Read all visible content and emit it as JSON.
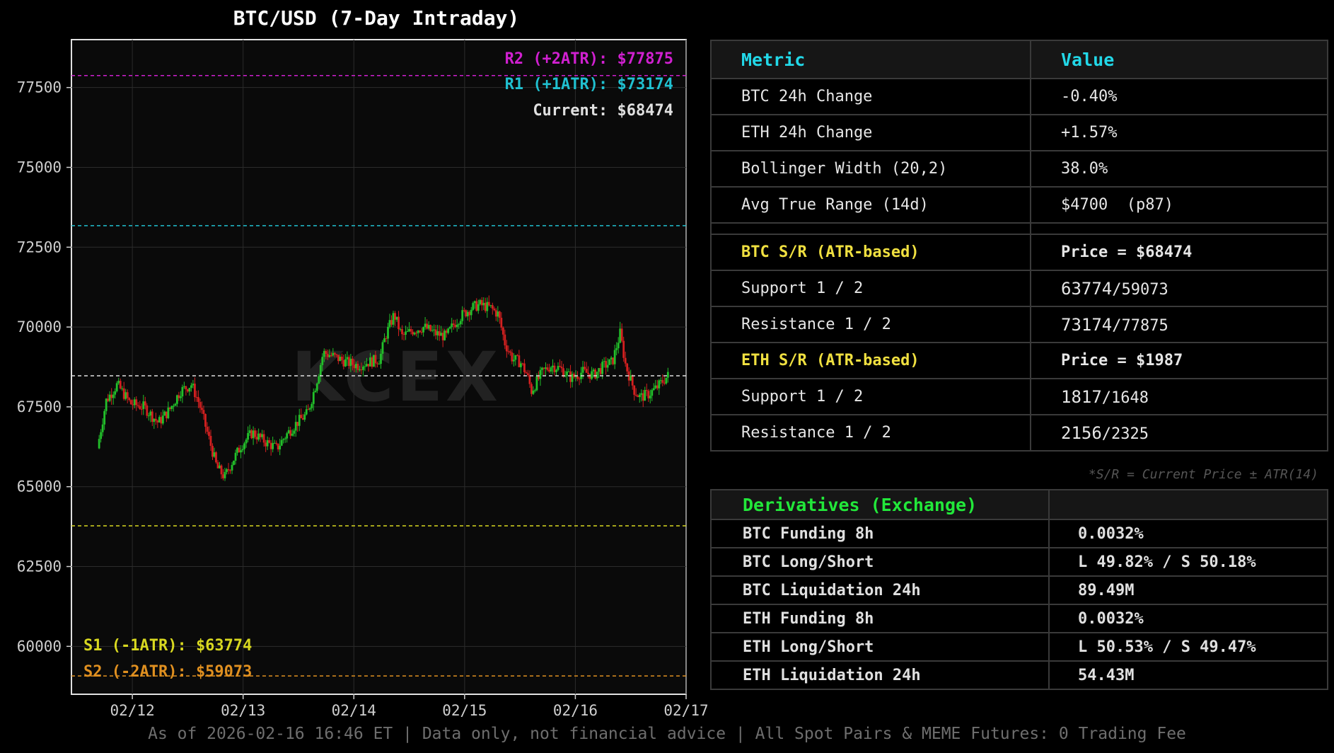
{
  "chart_data": {
    "type": "candlestick",
    "title": "BTC/USD (7-Day Intraday)",
    "xlabel": "",
    "ylabel": "",
    "x_ticks": [
      "02/12",
      "02/13",
      "02/14",
      "02/15",
      "02/16",
      "02/17"
    ],
    "y_ticks": [
      77500,
      75000,
      72500,
      70000,
      67500,
      65000,
      62500,
      60000
    ],
    "ylim": [
      58500,
      79000
    ],
    "x_range": [
      -0.55,
      5.0
    ],
    "grid": true,
    "levels": [
      {
        "label": "R2 (+2ATR): $77875",
        "value": 77875,
        "color": "#d020d0"
      },
      {
        "label": "R1 (+1ATR): $73174",
        "value": 73174,
        "color": "#20c0d0"
      },
      {
        "label": "Current: $68474",
        "value": 68474,
        "color": "#e0e0e0"
      },
      {
        "label": "S1 (-1ATR): $63774",
        "value": 63774,
        "color": "#d8d820"
      },
      {
        "label": "S2 (-2ATR): $59073",
        "value": 59073,
        "color": "#e09020"
      }
    ],
    "watermark": "KCEX",
    "price_path": [
      [
        -0.3,
        66200
      ],
      [
        -0.22,
        67700
      ],
      [
        -0.12,
        68200
      ],
      [
        0.0,
        67600
      ],
      [
        0.12,
        67500
      ],
      [
        0.25,
        67000
      ],
      [
        0.35,
        67400
      ],
      [
        0.45,
        68000
      ],
      [
        0.55,
        68200
      ],
      [
        0.62,
        67600
      ],
      [
        0.7,
        66600
      ],
      [
        0.78,
        65600
      ],
      [
        0.85,
        65300
      ],
      [
        0.92,
        65800
      ],
      [
        1.0,
        66300
      ],
      [
        1.1,
        66700
      ],
      [
        1.22,
        66400
      ],
      [
        1.32,
        66200
      ],
      [
        1.4,
        66600
      ],
      [
        1.5,
        67000
      ],
      [
        1.6,
        67300
      ],
      [
        1.68,
        68300
      ],
      [
        1.74,
        69200
      ],
      [
        1.82,
        69100
      ],
      [
        1.95,
        68900
      ],
      [
        2.05,
        68800
      ],
      [
        2.15,
        68900
      ],
      [
        2.25,
        69000
      ],
      [
        2.3,
        69700
      ],
      [
        2.38,
        70400
      ],
      [
        2.45,
        69700
      ],
      [
        2.55,
        69900
      ],
      [
        2.65,
        70000
      ],
      [
        2.75,
        69800
      ],
      [
        2.85,
        69700
      ],
      [
        2.92,
        70100
      ],
      [
        3.0,
        70400
      ],
      [
        3.08,
        70600
      ],
      [
        3.15,
        70700
      ],
      [
        3.25,
        70600
      ],
      [
        3.32,
        70400
      ],
      [
        3.38,
        69500
      ],
      [
        3.45,
        69000
      ],
      [
        3.52,
        68900
      ],
      [
        3.58,
        68500
      ],
      [
        3.62,
        68000
      ],
      [
        3.72,
        68600
      ],
      [
        3.8,
        68800
      ],
      [
        3.88,
        68700
      ],
      [
        3.98,
        68400
      ],
      [
        4.08,
        68600
      ],
      [
        4.18,
        68500
      ],
      [
        4.28,
        68800
      ],
      [
        4.35,
        68900
      ],
      [
        4.42,
        69800
      ],
      [
        4.47,
        68800
      ],
      [
        4.55,
        68000
      ],
      [
        4.6,
        67800
      ],
      [
        4.68,
        67900
      ],
      [
        4.75,
        68100
      ],
      [
        4.85,
        68474
      ]
    ]
  },
  "metrics": {
    "header": {
      "metric": "Metric",
      "value": "Value"
    },
    "rows": [
      {
        "label": "BTC 24h Change",
        "value": "-0.40%"
      },
      {
        "label": "ETH 24h Change",
        "value": "+1.57%"
      },
      {
        "label": "Bollinger Width (20,2)",
        "value": "38.0%"
      },
      {
        "label": "Avg True Range (14d)",
        "value": "$4700  (p87)"
      }
    ],
    "btc_sr": {
      "label": "BTC S/R (ATR-based)",
      "price": "Price = $68474",
      "support_label": "Support 1 / 2",
      "support_a": "63774",
      "support_b": "/59073",
      "resistance_label": "Resistance 1 / 2",
      "resistance_a": "73174",
      "resistance_b": "/77875"
    },
    "eth_sr": {
      "label": "ETH S/R (ATR-based)",
      "price": "Price = $1987",
      "support_label": "Support 1 / 2",
      "support_a": "1817",
      "support_b": "/1648",
      "resistance_label": "Resistance 1 / 2",
      "resistance_a": "2156",
      "resistance_b": "/2325"
    },
    "note": "*S/R = Current Price ± ATR(14)"
  },
  "derivatives": {
    "header": "Derivatives (Exchange)",
    "rows": [
      {
        "label": "BTC Funding 8h",
        "value": "0.0032%"
      },
      {
        "label": "BTC Long/Short",
        "value": "L 49.82% / S 50.18%"
      },
      {
        "label": "BTC Liquidation 24h",
        "value": "89.49M"
      },
      {
        "label": "ETH Funding 8h",
        "value": "0.0032%"
      },
      {
        "label": "ETH Long/Short",
        "value": "L 50.53% / S 49.47%"
      },
      {
        "label": "ETH Liquidation 24h",
        "value": "54.43M"
      }
    ]
  },
  "footer": "As of 2026-02-16 16:46 ET | Data only, not financial advice | All Spot Pairs & MEME Futures: 0 Trading Fee"
}
